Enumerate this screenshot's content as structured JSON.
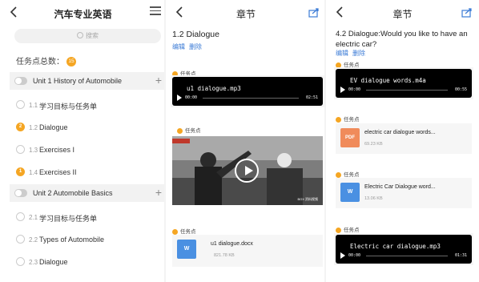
{
  "colors": {
    "accent_orange": "#f5a623",
    "link_blue": "#3b7bd6",
    "word_blue": "#4a90e2",
    "pdf_orange": "#f08b5b"
  },
  "panel1": {
    "title": "汽车专业英语",
    "search_placeholder": "搜索",
    "count_label": "任务点总数：",
    "count_value": "15",
    "units": [
      {
        "label": "Unit 1 History of Automobile",
        "sections": [
          {
            "num": "1.1",
            "label": "学习目标与任务单",
            "badge": ""
          },
          {
            "num": "1.2",
            "label": "Dialogue",
            "badge": "2"
          },
          {
            "num": "1.3",
            "label": "Exercises I",
            "badge": ""
          },
          {
            "num": "1.4",
            "label": "Exercises II",
            "badge": "1"
          }
        ]
      },
      {
        "label": "Unit 2 Automobile Basics",
        "sections": [
          {
            "num": "2.1",
            "label": "学习目标与任务单",
            "badge": ""
          },
          {
            "num": "2.2",
            "label": "Types of Automobile",
            "badge": ""
          },
          {
            "num": "2.3",
            "label": "Dialogue",
            "badge": ""
          }
        ]
      }
    ]
  },
  "panel2": {
    "title": "章节",
    "heading": "1.2 Dialogue",
    "edit": "编辑",
    "delete": "删除",
    "task_label": "任务点",
    "audio": {
      "name": "u1 dialogue.mp3",
      "start": "00:00",
      "end": "02:51"
    },
    "video": {
      "watermark": "BOX 资料视频"
    },
    "doc": {
      "name": "u1 dialogue.docx",
      "size": "821.78 KB",
      "icon_text": "W"
    }
  },
  "panel3": {
    "title": "章节",
    "heading": "4.2 Dialogue:Would you like to have an electric car?",
    "edit": "编辑",
    "delete": "删除",
    "task_label": "任务点",
    "audio1": {
      "name": "EV dialogue words.m4a",
      "start": "00:00",
      "end": "00:55"
    },
    "pdf": {
      "name": "electric car dialogue words...",
      "size": "69.23 KB",
      "icon_text": "PDF"
    },
    "word": {
      "name": "Electric Car Dialogue word...",
      "size": "13.06 KB",
      "icon_text": "W"
    },
    "audio2": {
      "name": "Electric car dialogue.mp3",
      "start": "00:00",
      "end": "01:31"
    }
  }
}
